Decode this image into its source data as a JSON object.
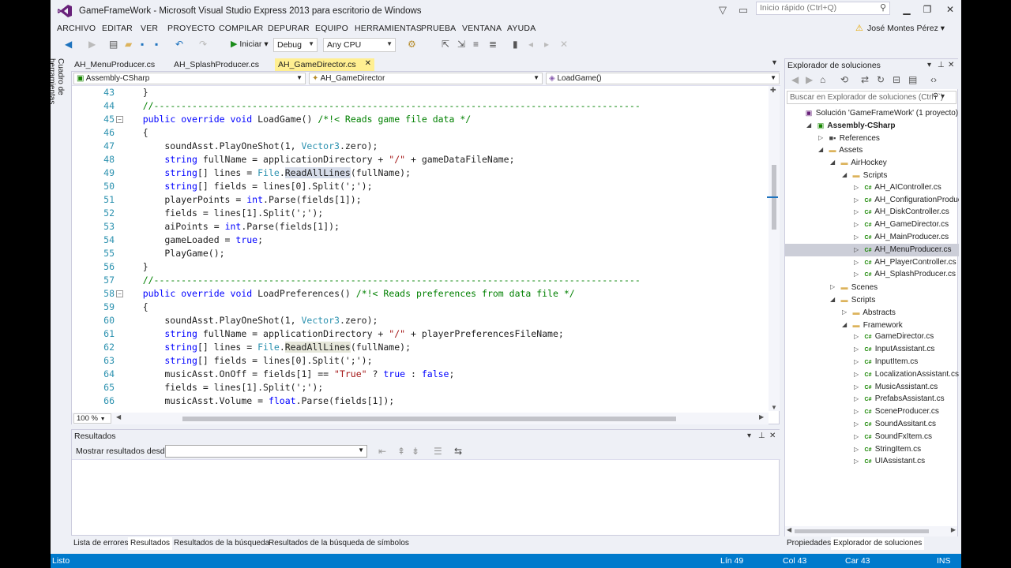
{
  "window": {
    "title": "GameFrameWork - Microsoft Visual Studio Express 2013 para escritorio de Windows",
    "quick_launch_placeholder": "Inicio rápido (Ctrl+Q)",
    "logo_icon": "vs-logo-icon"
  },
  "menu": [
    "ARCHIVO",
    "EDITAR",
    "VER",
    "PROYECTO",
    "COMPILAR",
    "DEPURAR",
    "EQUIPO",
    "HERRAMIENTAS",
    "PRUEBA",
    "VENTANA",
    "AYUDA"
  ],
  "user": "José Montes Pérez",
  "toolbar": {
    "start_label": "Iniciar",
    "config": "Debug",
    "platform": "Any CPU"
  },
  "toolbox_tab": "Cuadro de herramientas",
  "doc_tabs": [
    "AH_MenuProducer.cs",
    "AH_SplashProducer.cs",
    "AH_GameDirector.cs"
  ],
  "active_doc_tab": "AH_GameDirector.cs",
  "nav": {
    "project": "Assembly-CSharp",
    "class": "AH_GameDirector",
    "member": "LoadGame()"
  },
  "code_lines": [
    {
      "n": "43",
      "t": "    }"
    },
    {
      "n": "44",
      "t": "    //-----------------------------------------------------------------------------------------"
    },
    {
      "n": "45",
      "t": "    public override void LoadGame() /*!< Reads game file data */"
    },
    {
      "n": "46",
      "t": "    {"
    },
    {
      "n": "47",
      "t": "        soundAsst.PlayOneShot(1, Vector3.zero);"
    },
    {
      "n": "48",
      "t": "        string fullName = applicationDirectory + \"/\" + gameDataFileName;"
    },
    {
      "n": "49",
      "t": "        string[] lines = File.ReadAllLines(fullName);"
    },
    {
      "n": "50",
      "t": "        string[] fields = lines[0].Split(';');"
    },
    {
      "n": "51",
      "t": "        playerPoints = int.Parse(fields[1]);"
    },
    {
      "n": "52",
      "t": "        fields = lines[1].Split(';');"
    },
    {
      "n": "53",
      "t": "        aiPoints = int.Parse(fields[1]);"
    },
    {
      "n": "54",
      "t": "        gameLoaded = true;"
    },
    {
      "n": "55",
      "t": "        PlayGame();"
    },
    {
      "n": "56",
      "t": "    }"
    },
    {
      "n": "57",
      "t": "    //-----------------------------------------------------------------------------------------"
    },
    {
      "n": "58",
      "t": "    public override void LoadPreferences() /*!< Reads preferences from data file */"
    },
    {
      "n": "59",
      "t": "    {"
    },
    {
      "n": "60",
      "t": "        soundAsst.PlayOneShot(1, Vector3.zero);"
    },
    {
      "n": "61",
      "t": "        string fullName = applicationDirectory + \"/\" + playerPreferencesFileName;"
    },
    {
      "n": "62",
      "t": "        string[] lines = File.ReadAllLines(fullName);"
    },
    {
      "n": "63",
      "t": "        string[] fields = lines[0].Split(';');"
    },
    {
      "n": "64",
      "t": "        musicAsst.OnOff = fields[1] == \"True\" ? true : false;"
    },
    {
      "n": "65",
      "t": "        fields = lines[1].Split(';');"
    },
    {
      "n": "66",
      "t": "        musicAsst.Volume = float.Parse(fields[1]);"
    }
  ],
  "zoom": "100 %",
  "output": {
    "title": "Resultados",
    "show_from_label": "Mostrar resultados desde:"
  },
  "bottom_tabs": [
    "Lista de errores",
    "Resultados",
    "Resultados de la búsqueda",
    "Resultados de la búsqueda de símbolos"
  ],
  "solution_explorer": {
    "title": "Explorador de soluciones",
    "search_placeholder": "Buscar en Explorador de soluciones (Ctrl+`)",
    "tree": [
      {
        "label": "Solución 'GameFrameWork' (1 proyecto)",
        "kind": "sln",
        "depth": 0,
        "tw": ""
      },
      {
        "label": "Assembly-CSharp",
        "kind": "proj",
        "depth": 1,
        "tw": "open",
        "bold": true
      },
      {
        "label": "References",
        "kind": "ref",
        "depth": 2,
        "tw": "closed"
      },
      {
        "label": "Assets",
        "kind": "folder",
        "depth": 2,
        "tw": "open"
      },
      {
        "label": "AirHockey",
        "kind": "folder",
        "depth": 3,
        "tw": "open"
      },
      {
        "label": "Scripts",
        "kind": "folder",
        "depth": 4,
        "tw": "open"
      },
      {
        "label": "AH_AIController.cs",
        "kind": "cs",
        "depth": 5,
        "tw": "closed"
      },
      {
        "label": "AH_ConfigurationProducer.cs",
        "kind": "cs",
        "depth": 5,
        "tw": "closed"
      },
      {
        "label": "AH_DiskController.cs",
        "kind": "cs",
        "depth": 5,
        "tw": "closed"
      },
      {
        "label": "AH_GameDirector.cs",
        "kind": "cs",
        "depth": 5,
        "tw": "closed"
      },
      {
        "label": "AH_MainProducer.cs",
        "kind": "cs",
        "depth": 5,
        "tw": "closed"
      },
      {
        "label": "AH_MenuProducer.cs",
        "kind": "cs",
        "depth": 5,
        "tw": "closed",
        "sel": true
      },
      {
        "label": "AH_PlayerController.cs",
        "kind": "cs",
        "depth": 5,
        "tw": "closed"
      },
      {
        "label": "AH_SplashProducer.cs",
        "kind": "cs",
        "depth": 5,
        "tw": "closed"
      },
      {
        "label": "Scenes",
        "kind": "folder",
        "depth": 3,
        "tw": "closed"
      },
      {
        "label": "Scripts",
        "kind": "folder",
        "depth": 3,
        "tw": "open"
      },
      {
        "label": "Abstracts",
        "kind": "folder",
        "depth": 4,
        "tw": "closed"
      },
      {
        "label": "Framework",
        "kind": "folder",
        "depth": 4,
        "tw": "open"
      },
      {
        "label": "GameDirector.cs",
        "kind": "cs",
        "depth": 5,
        "tw": "closed"
      },
      {
        "label": "InputAssistant.cs",
        "kind": "cs",
        "depth": 5,
        "tw": "closed"
      },
      {
        "label": "InputItem.cs",
        "kind": "cs",
        "depth": 5,
        "tw": "closed"
      },
      {
        "label": "LocalizationAssistant.cs",
        "kind": "cs",
        "depth": 5,
        "tw": "closed"
      },
      {
        "label": "MusicAssistant.cs",
        "kind": "cs",
        "depth": 5,
        "tw": "closed"
      },
      {
        "label": "PrefabsAssistant.cs",
        "kind": "cs",
        "depth": 5,
        "tw": "closed"
      },
      {
        "label": "SceneProducer.cs",
        "kind": "cs",
        "depth": 5,
        "tw": "closed"
      },
      {
        "label": "SoundAssitant.cs",
        "kind": "cs",
        "depth": 5,
        "tw": "closed"
      },
      {
        "label": "SoundFxItem.cs",
        "kind": "cs",
        "depth": 5,
        "tw": "closed"
      },
      {
        "label": "StringItem.cs",
        "kind": "cs",
        "depth": 5,
        "tw": "closed"
      },
      {
        "label": "UIAssistant.cs",
        "kind": "cs",
        "depth": 5,
        "tw": "closed"
      }
    ]
  },
  "side_tabs": [
    "Propiedades",
    "Explorador de soluciones"
  ],
  "status": {
    "left": "Listo",
    "line": "Lín 49",
    "col": "Col 43",
    "car": "Car 43",
    "mode": "INS"
  },
  "colors": {
    "accent": "#007acc",
    "brand": "#68217a",
    "active_tab": "#ffef91"
  }
}
